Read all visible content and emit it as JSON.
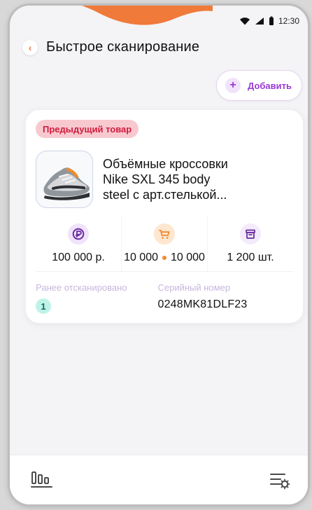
{
  "status": {
    "time": "12:30"
  },
  "header": {
    "title": "Быстрое сканирование",
    "add_label": "Добавить"
  },
  "product": {
    "badge": "Предыдущий товар",
    "title": "Объёмные кроссовки\nNike SXL 345 body\nsteel с арт.стелькой...",
    "price": "100 000 р.",
    "cart_left": "10 000",
    "cart_right": "10 000",
    "quantity": "1 200 шт.",
    "scanned_label": "Ранее отсканировано",
    "scanned_count": "1",
    "serial_label": "Серийный номер",
    "serial_value": "0248MK81DLF23"
  },
  "colors": {
    "accent_orange": "#f28a2e",
    "accent_purple": "#9a39d6",
    "badge_bg": "#f7c9cf",
    "badge_text": "#d11b3d"
  },
  "icons": {
    "back": "back-icon",
    "plus": "plus-icon",
    "ruble": "ruble-coin-icon",
    "cart": "cart-icon",
    "archive": "archive-box-icon",
    "chart": "bar-chart-icon",
    "settings": "list-settings-icon"
  }
}
